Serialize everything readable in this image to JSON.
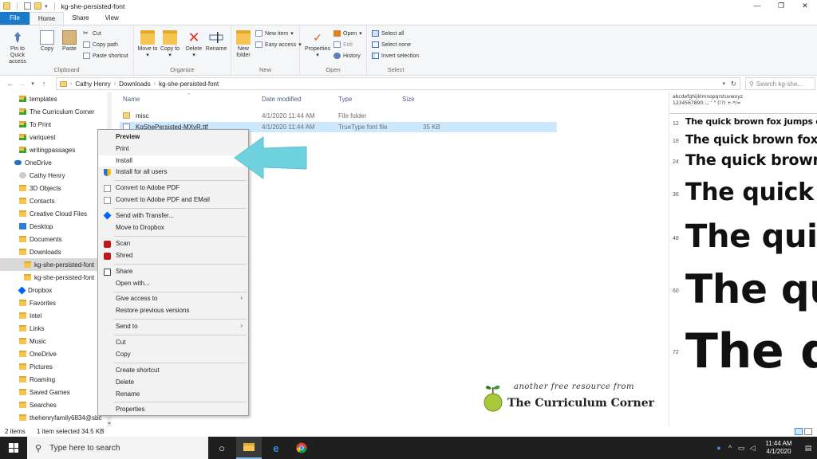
{
  "window": {
    "title": "kg-she-persisted-font",
    "controls": {
      "minimize": "—",
      "maximize": "❐",
      "close": "✕"
    }
  },
  "ribbon": {
    "tabs": [
      "File",
      "Home",
      "Share",
      "View"
    ],
    "active_tab": "Home",
    "groups": {
      "clipboard": {
        "label": "Clipboard",
        "pin": "Pin to Quick access",
        "copy": "Copy",
        "paste": "Paste",
        "cut": "Cut",
        "copy_path": "Copy path",
        "paste_shortcut": "Paste shortcut"
      },
      "organize": {
        "label": "Organize",
        "move_to": "Move to",
        "copy_to": "Copy to",
        "delete": "Delete",
        "rename": "Rename"
      },
      "new": {
        "label": "New",
        "new_folder": "New folder",
        "new_item": "New item",
        "easy_access": "Easy access"
      },
      "open": {
        "label": "Open",
        "properties": "Properties",
        "open": "Open",
        "edit": "Edit",
        "history": "History"
      },
      "select": {
        "label": "Select",
        "select_all": "Select all",
        "select_none": "Select none",
        "invert_selection": "Invert selection"
      }
    }
  },
  "address": {
    "crumbs": [
      "Cathy Henry",
      "Downloads",
      "kg-she-persisted-font"
    ],
    "search_placeholder": "Search kg-she..."
  },
  "nav_pane": {
    "items": [
      {
        "label": "templates",
        "icon": "folder-green"
      },
      {
        "label": "The Curriculum Corner",
        "icon": "folder-green"
      },
      {
        "label": "To Print",
        "icon": "folder-green"
      },
      {
        "label": "variquest",
        "icon": "folder-green"
      },
      {
        "label": "writingpassages",
        "icon": "folder-green"
      },
      {
        "label": "OneDrive",
        "icon": "cloud"
      },
      {
        "label": "Cathy Henry",
        "icon": "user"
      },
      {
        "label": "3D Objects",
        "icon": "folder"
      },
      {
        "label": "Contacts",
        "icon": "folder"
      },
      {
        "label": "Creative Cloud Files",
        "icon": "folder"
      },
      {
        "label": "Desktop",
        "icon": "folder-blue"
      },
      {
        "label": "Documents",
        "icon": "folder"
      },
      {
        "label": "Downloads",
        "icon": "folder"
      },
      {
        "label": "kg-she-persisted-font",
        "icon": "folder"
      },
      {
        "label": "kg-she-persisted-font",
        "icon": "folder"
      },
      {
        "label": "Dropbox",
        "icon": "dropbox"
      },
      {
        "label": "Favorites",
        "icon": "folder"
      },
      {
        "label": "Intel",
        "icon": "folder"
      },
      {
        "label": "Links",
        "icon": "folder"
      },
      {
        "label": "Music",
        "icon": "folder"
      },
      {
        "label": "OneDrive",
        "icon": "folder"
      },
      {
        "label": "Pictures",
        "icon": "folder"
      },
      {
        "label": "Roaming",
        "icon": "folder"
      },
      {
        "label": "Saved Games",
        "icon": "folder"
      },
      {
        "label": "Searches",
        "icon": "folder"
      },
      {
        "label": "thehenryfamily6834@sbc",
        "icon": "folder"
      }
    ],
    "selected": "kg-she-persisted-font"
  },
  "file_list": {
    "columns": [
      "Name",
      "Date modified",
      "Type",
      "Size"
    ],
    "rows": [
      {
        "name": "misc",
        "date": "4/1/2020 11:44 AM",
        "type": "File folder",
        "size": ""
      },
      {
        "name": "KgShePersisted-MXvR.ttf",
        "date": "4/1/2020 11:44 AM",
        "type": "TrueType font file",
        "size": "35 KB"
      }
    ]
  },
  "context_menu": {
    "items": [
      "Preview",
      "Print",
      "Install",
      "Install for all users",
      "Convert to Adobe PDF",
      "Convert to Adobe PDF and EMail",
      "Send with Transfer...",
      "Move to Dropbox",
      "Scan",
      "Shred",
      "Share",
      "Open with...",
      "Give access to",
      "Restore previous versions",
      "Send to",
      "Cut",
      "Copy",
      "Create shortcut",
      "Delete",
      "Rename",
      "Properties"
    ]
  },
  "preview": {
    "charset_line1": "abcdefghijklmnopqrstuvwxyz",
    "charset_line2": "1234567890.:,; ' \" (!?) +-*/=",
    "sample_text": "The quick brown fox jumps over the lazy dog",
    "rows": [
      {
        "size": "12",
        "text": "The quick brown fox jumps over the lazy dog"
      },
      {
        "size": "18",
        "text": "The quick brown fox jumps over the lazy dog"
      },
      {
        "size": "24",
        "text": "The quick brown fox jumps"
      },
      {
        "size": "36",
        "text": "The quick brown"
      },
      {
        "size": "48",
        "text": "The quick"
      },
      {
        "size": "60",
        "text": "The quick"
      },
      {
        "size": "72",
        "text": "The qu"
      }
    ]
  },
  "watermark": {
    "line1": "another free resource from",
    "line2": "The Curriculum Corner"
  },
  "status": {
    "items": "2 items",
    "selected": "1 item selected  34.5 KB"
  },
  "taskbar": {
    "search_placeholder": "Type here to search",
    "time": "11:44 AM",
    "date": "4/1/2020"
  },
  "colors": {
    "accent": "#1979ca",
    "selection": "#cce8ff",
    "arrow": "#6fd0de"
  }
}
